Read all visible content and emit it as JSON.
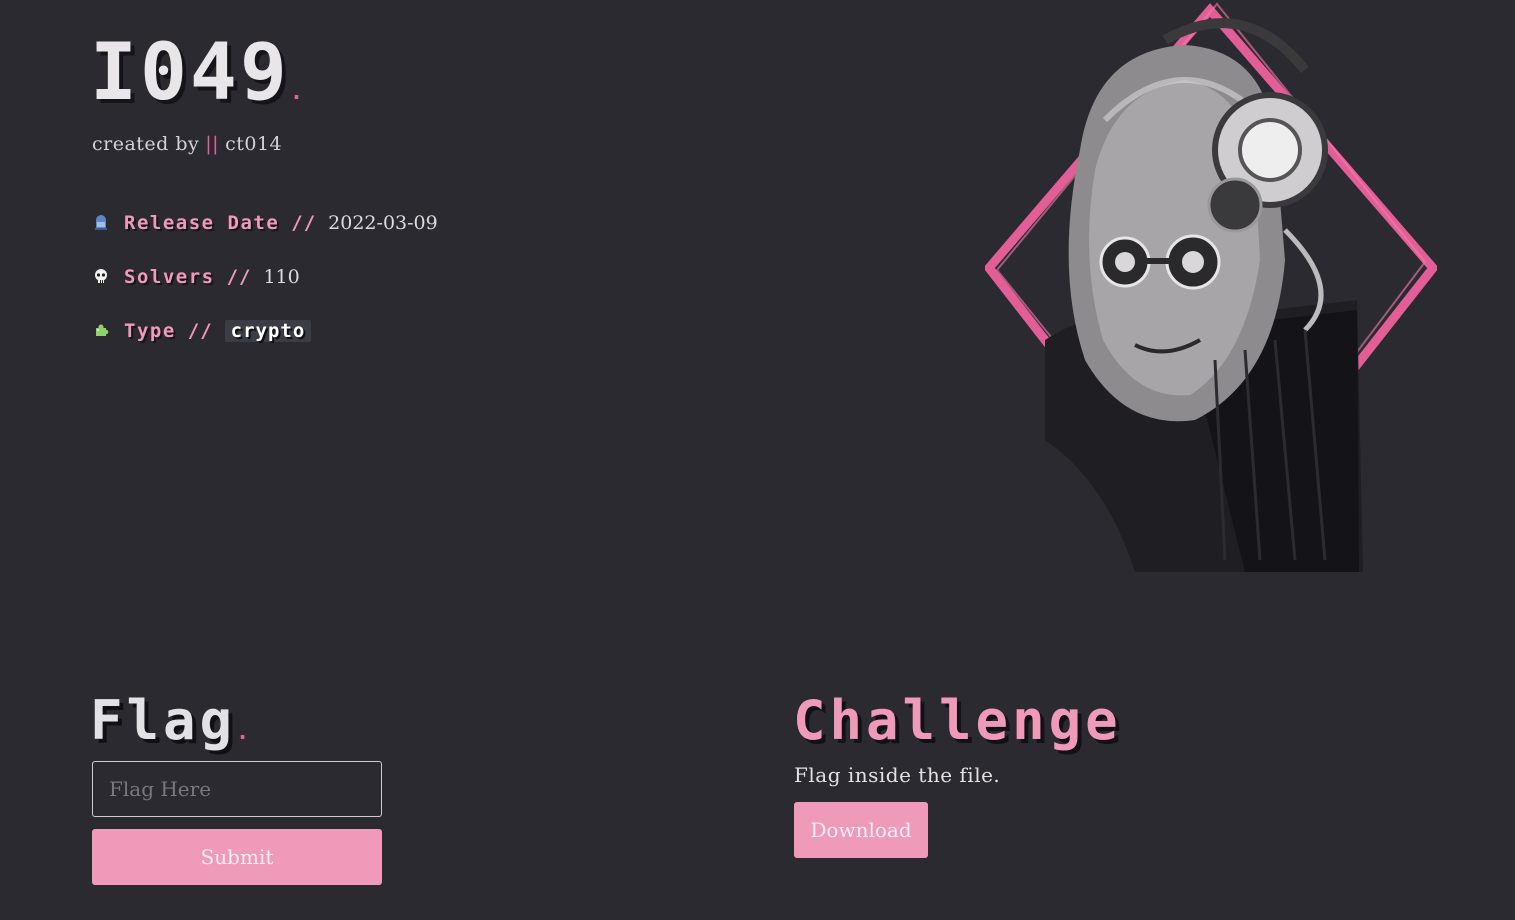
{
  "challenge": {
    "title": "I049",
    "title_dot": ".",
    "created_by_label": "created by",
    "created_by_sep": "||",
    "author": "ct014"
  },
  "meta": {
    "release_date": {
      "icon": "tombstone-icon",
      "label": "Release Date",
      "sep": "//",
      "value": "2022-03-09"
    },
    "solvers": {
      "icon": "skull-icon",
      "label": "Solvers",
      "sep": "//",
      "value": "110"
    },
    "type": {
      "icon": "puzzle-icon",
      "label": "Type",
      "sep": "//",
      "value": "crypto"
    }
  },
  "flag_section": {
    "title": "Flag",
    "title_dot": ".",
    "input_placeholder": "Flag Here",
    "input_value": "",
    "submit_label": "Submit"
  },
  "challenge_section": {
    "title": "Challenge",
    "description": "Flag inside the file.",
    "download_label": "Download"
  },
  "colors": {
    "background": "#2b2a30",
    "accent_pink": "#ef9ab9",
    "accent_magenta": "#e5609b",
    "text": "#e6e3e6"
  }
}
